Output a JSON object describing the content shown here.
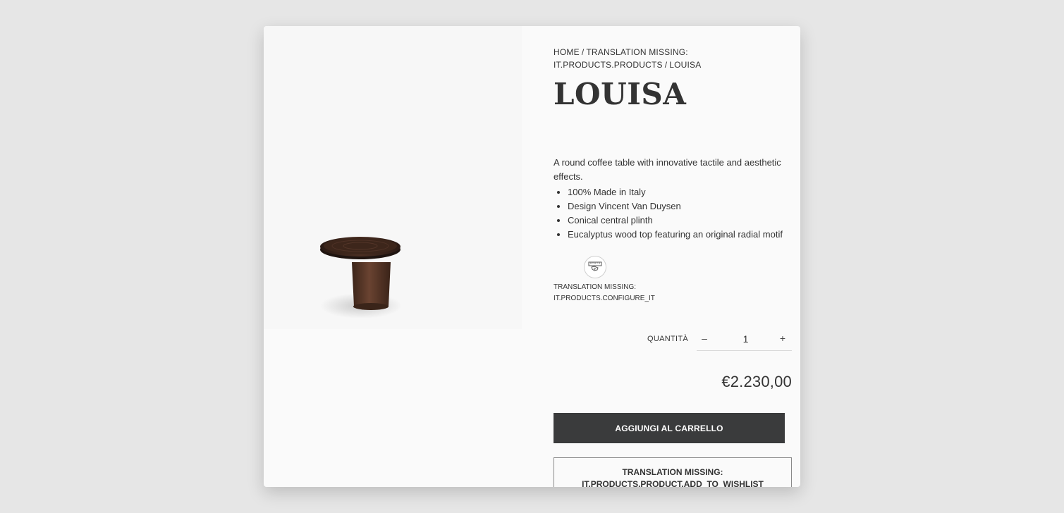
{
  "breadcrumb": {
    "home": "HOME",
    "separator": "/",
    "category": "TRANSLATION MISSING: IT.PRODUCTS.PRODUCTS",
    "current": "LOUISA"
  },
  "product": {
    "title": "LOUISA",
    "image_icon": "coffee-table-image",
    "description": "A round coffee table with innovative tactile and aesthetic effects.",
    "features": [
      "100% Made in Italy",
      "Design Vincent Van Duysen",
      "Conical central plinth",
      "Eucalyptus wood top featuring an original radial motif"
    ],
    "price": "€2.230,00"
  },
  "configure": {
    "icon": "ruler-hand-icon",
    "label": "TRANSLATION MISSING: IT.PRODUCTS.CONFIGURE_IT"
  },
  "quantity": {
    "label": "QUANTITÀ",
    "minus": "–",
    "plus": "+",
    "value": "1"
  },
  "actions": {
    "add_to_cart": "AGGIUNGI AL CARRELLO",
    "add_to_wishlist": "TRANSLATION MISSING: IT.PRODUCTS.PRODUCT.ADD_TO_WISHLIST"
  },
  "colors": {
    "background": "#e6e6e6",
    "card": "#fafafa",
    "button_dark": "#3a3b3c",
    "text": "#333333"
  }
}
